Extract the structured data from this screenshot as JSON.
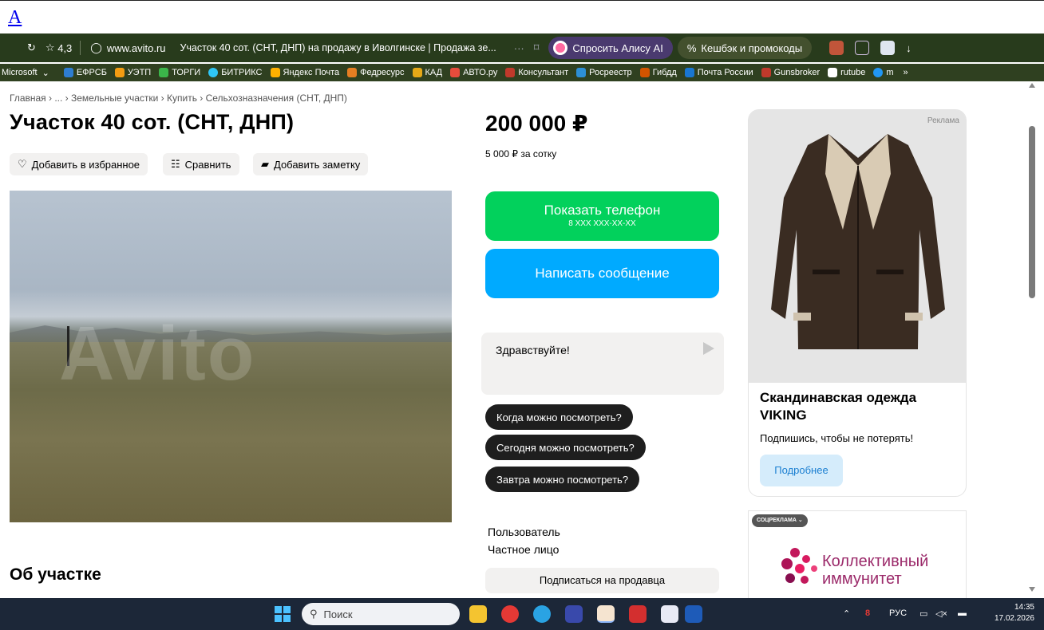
{
  "top_link": "A",
  "browser": {
    "rating": "4,3",
    "domain": "www.avito.ru",
    "tab_title": "Участок 40 сот. (СНТ, ДНП) на продажу в Иволгинске | Продажа зе...",
    "more": "···",
    "alice_button": "Спросить Алису AI",
    "cashback_button": "Кешбэк и промокоды"
  },
  "bookmarks": [
    {
      "label": "Microsoft",
      "color": "#8ab4f8"
    },
    {
      "label": "ЕФРСБ",
      "color": "#2e7dd1"
    },
    {
      "label": "УЭТП",
      "color": "#f39c12"
    },
    {
      "label": "ТОРГИ",
      "color": "#3bb54a"
    },
    {
      "label": "БИТРИКС",
      "color": "#2fc6f6"
    },
    {
      "label": "Яндекс Почта",
      "color": "#ffb000"
    },
    {
      "label": "Федресурс",
      "color": "#e67e22"
    },
    {
      "label": "КАД",
      "color": "#e6a817"
    },
    {
      "label": "АВТО.ру",
      "color": "#e74c3c"
    },
    {
      "label": "Консультант",
      "color": "#c0392b"
    },
    {
      "label": "Росреестр",
      "color": "#2d8fd6"
    },
    {
      "label": "Гибдд",
      "color": "#d35400"
    },
    {
      "label": "Почта России",
      "color": "#1976d2"
    },
    {
      "label": "Gunsbroker",
      "color": "#c0392b"
    },
    {
      "label": "rutube",
      "color": "#1a1a2e"
    },
    {
      "label": "m",
      "color": "#2196f3"
    },
    {
      "label": "»",
      "color": ""
    }
  ],
  "breadcrumb": "Главная › ... › Земельные участки › Купить › Сельхозназначения (СНТ, ДНП)",
  "listing": {
    "title": "Участок 40 сот. (СНТ, ДНП)",
    "favorite": "Добавить в избранное",
    "compare": "Сравнить",
    "note": "Добавить заметку",
    "watermark": "Avito",
    "about": "Об участке"
  },
  "price": {
    "value": "200 000 ₽",
    "per_unit": "5 000 ₽ за сотку"
  },
  "contact": {
    "show_phone": "Показать телефон",
    "phone_mask": "8 XXX XXX-XX-XX",
    "write_message": "Написать сообщение",
    "message_text": "Здравствуйте!",
    "quick_replies": [
      "Когда можно посмотреть?",
      "Сегодня можно посмотреть?",
      "Завтра можно посмотреть?"
    ],
    "seller_name": "Пользователь",
    "seller_type": "Частное лицо",
    "subscribe": "Подписаться на продавца"
  },
  "ad": {
    "label": "Реклама",
    "title": "Скандинавская одежда VIKING",
    "subtitle": "Подпишись, чтобы не потерять!",
    "button": "Подробнее"
  },
  "social_ad": {
    "tag": "СОЦРЕКЛАМА",
    "name_line1": "Коллективный",
    "name_line2": "иммунитет"
  },
  "taskbar": {
    "search": "Поиск",
    "lang": "РУС",
    "time": "14:35",
    "date": "17.02.2026"
  }
}
